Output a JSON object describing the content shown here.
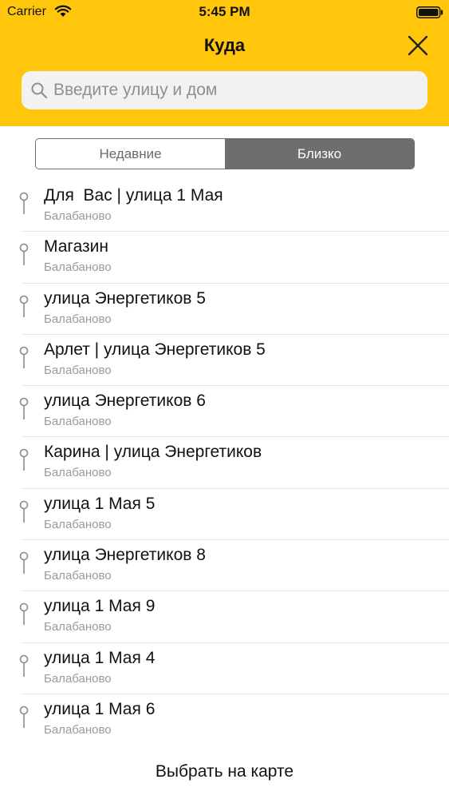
{
  "status_bar": {
    "carrier": "Carrier",
    "time": "5:45 PM"
  },
  "nav": {
    "title": "Куда"
  },
  "search": {
    "placeholder": "Введите улицу и дом",
    "value": ""
  },
  "tabs": [
    {
      "label": "Недавние",
      "selected": false
    },
    {
      "label": "Близко",
      "selected": true
    }
  ],
  "places": [
    {
      "title": "Для  Вас | улица 1 Мая",
      "subtitle": "Балабаново"
    },
    {
      "title": "Магазин",
      "subtitle": "Балабаново"
    },
    {
      "title": "улица Энергетиков 5",
      "subtitle": "Балабаново"
    },
    {
      "title": "Арлет | улица Энергетиков 5",
      "subtitle": "Балабаново"
    },
    {
      "title": "улица Энергетиков 6",
      "subtitle": "Балабаново"
    },
    {
      "title": "Карина | улица Энергетиков",
      "subtitle": "Балабаново"
    },
    {
      "title": "улица 1 Мая 5",
      "subtitle": "Балабаново"
    },
    {
      "title": "улица Энергетиков 8",
      "subtitle": "Балабаново"
    },
    {
      "title": "улица 1 Мая 9",
      "subtitle": "Балабаново"
    },
    {
      "title": "улица 1 Мая 4",
      "subtitle": "Балабаново"
    },
    {
      "title": "улица 1 Мая 6",
      "subtitle": "Балабаново"
    }
  ],
  "footer": {
    "choose_on_map": "Выбрать на карте"
  },
  "colors": {
    "header_bg": "#FFC60B",
    "tab_active_bg": "#6E6E6E",
    "subtitle_text": "#9A9A9A"
  },
  "icons": {
    "wifi": "wifi-icon",
    "battery": "battery-icon",
    "close": "close-icon",
    "search": "search-icon",
    "place": "pin-icon"
  }
}
